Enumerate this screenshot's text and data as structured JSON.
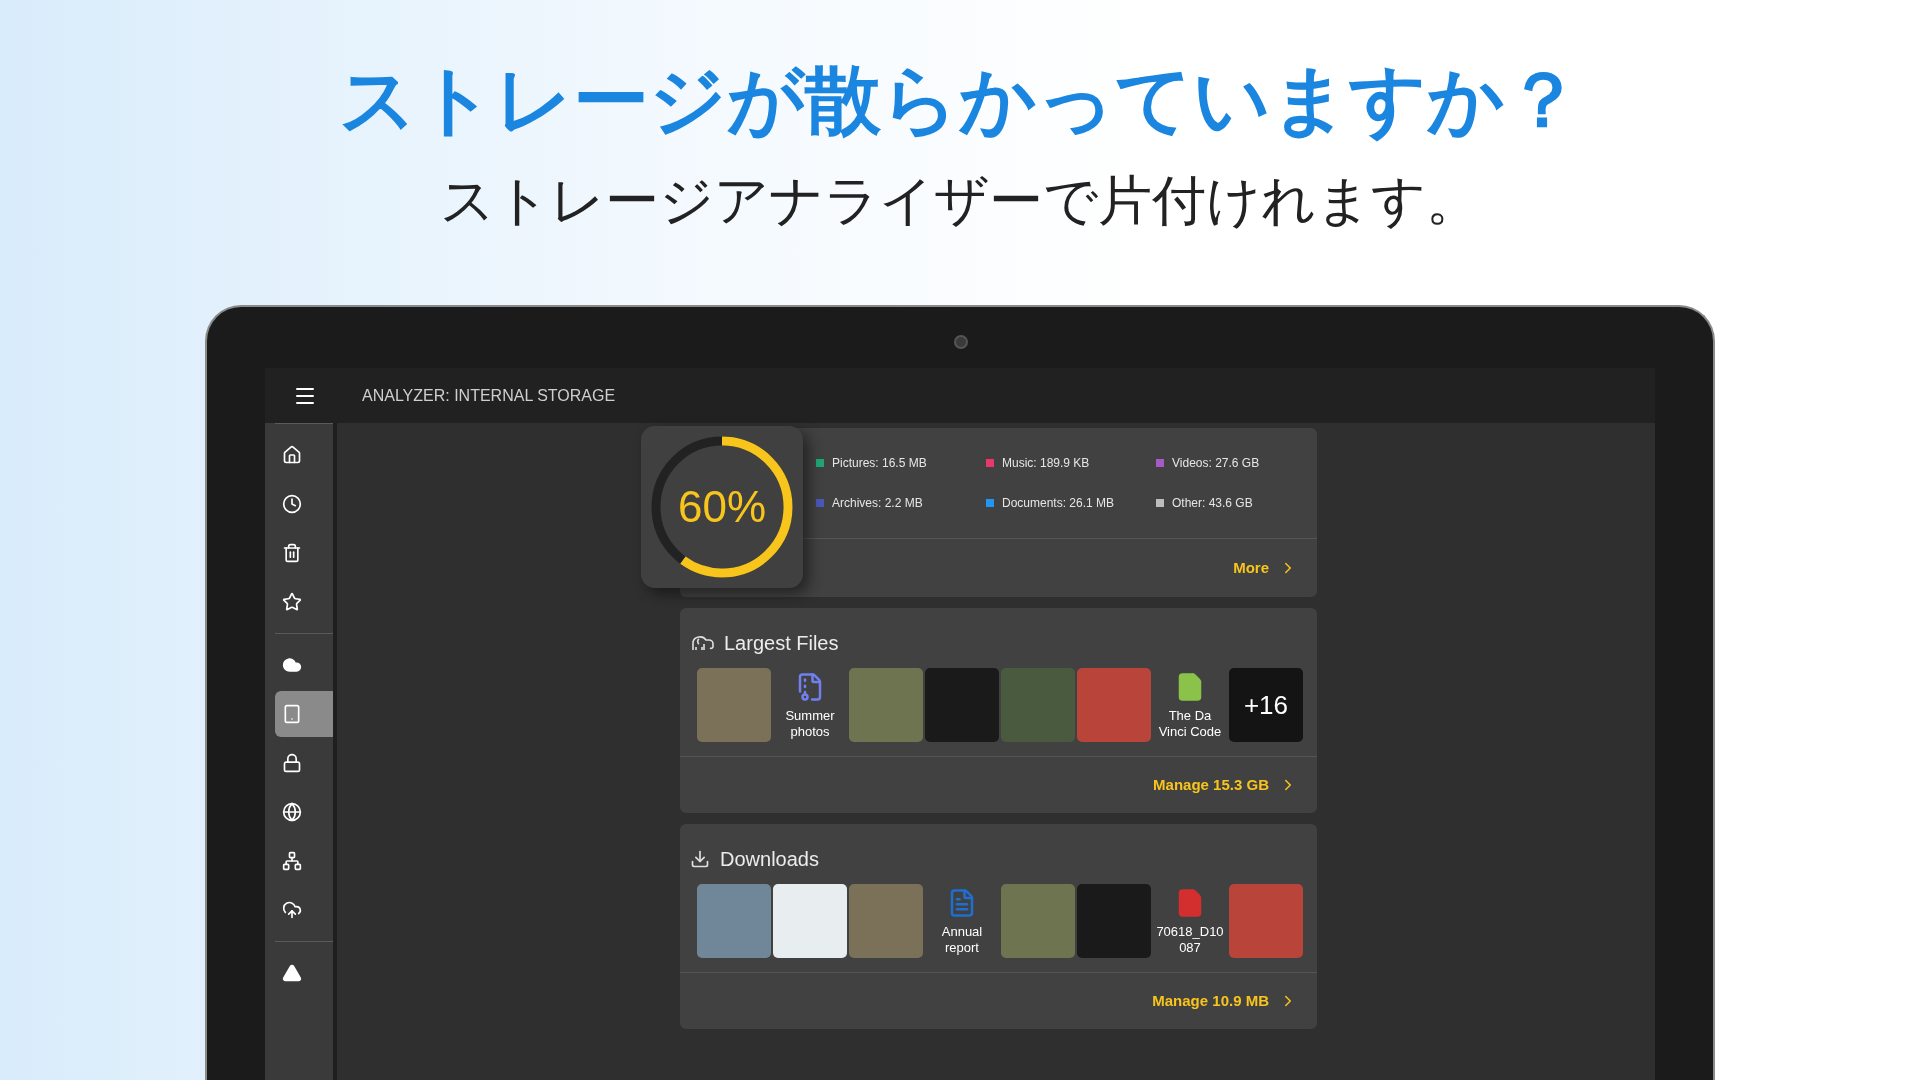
{
  "promo": {
    "headline": "ストレージが散らかっていますか？",
    "subtitle": "ストレージアナライザーで片付けれます。"
  },
  "app_bar": {
    "title": "ANALYZER: INTERNAL STORAGE"
  },
  "sidebar": {
    "sections": [
      [
        {
          "kind": "home",
          "selected": false
        },
        {
          "kind": "history",
          "selected": false
        },
        {
          "kind": "trash",
          "selected": false
        },
        {
          "kind": "star",
          "selected": false
        }
      ],
      [
        {
          "kind": "cloud",
          "selected": false
        },
        {
          "kind": "tablet",
          "selected": true
        },
        {
          "kind": "lock",
          "selected": false
        },
        {
          "kind": "globe",
          "selected": false
        },
        {
          "kind": "network",
          "selected": false
        },
        {
          "kind": "cloud-add",
          "selected": false
        }
      ],
      [
        {
          "kind": "drive",
          "selected": false
        }
      ]
    ]
  },
  "storage": {
    "percent": "60%",
    "level": 0.6,
    "legend": [
      {
        "label": "Pictures: 16.5 MB",
        "color": "#1fa774"
      },
      {
        "label": "Music: 189.9 KB",
        "color": "#e8386b"
      },
      {
        "label": "Videos: 27.6 GB",
        "color": "#a55ac8"
      },
      {
        "label": "Archives: 2.2 MB",
        "color": "#4a58b8"
      },
      {
        "label": "Documents: 26.1 MB",
        "color": "#2196f3"
      },
      {
        "label": "Other: 43.6 GB",
        "color": "#bdbdbd"
      }
    ],
    "more": "More"
  },
  "sections": [
    {
      "kind": "largest",
      "title": "Largest Files",
      "items": [
        {
          "kind": "photo"
        },
        {
          "kind": "archive",
          "label": "Summer photos"
        },
        {
          "kind": "photo"
        },
        {
          "kind": "photo"
        },
        {
          "kind": "photo"
        },
        {
          "kind": "photo"
        },
        {
          "kind": "ebook",
          "label": "The Da Vinci Code"
        },
        {
          "kind": "more",
          "label": "+16"
        }
      ],
      "action": "Manage 15.3 GB"
    },
    {
      "kind": "downloads",
      "title": "Downloads",
      "items": [
        {
          "kind": "photo"
        },
        {
          "kind": "photo"
        },
        {
          "kind": "photo"
        },
        {
          "kind": "document",
          "label": "Annual report"
        },
        {
          "kind": "photo"
        },
        {
          "kind": "photo"
        },
        {
          "kind": "pdf",
          "label": "70618_D10087"
        },
        {
          "kind": "photo"
        }
      ],
      "action": "Manage 10.9 MB"
    }
  ]
}
